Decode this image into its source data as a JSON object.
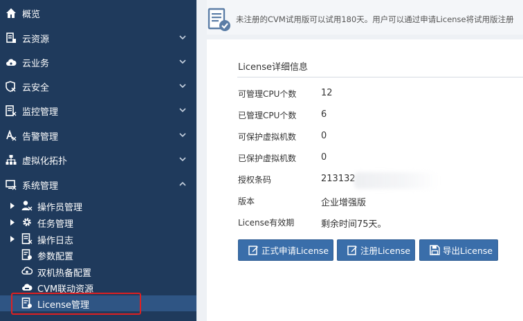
{
  "sidebar": {
    "items": [
      {
        "label": "概览",
        "icon": "home-icon",
        "expanded": false
      },
      {
        "label": "云资源",
        "icon": "server-icon",
        "expanded": false
      },
      {
        "label": "云业务",
        "icon": "cloud-icon",
        "expanded": false
      },
      {
        "label": "云安全",
        "icon": "shield-icon",
        "expanded": false
      },
      {
        "label": "监控管理",
        "icon": "monitor-doc-icon",
        "expanded": false
      },
      {
        "label": "告警管理",
        "icon": "alarm-icon",
        "expanded": false
      },
      {
        "label": "虚拟化拓扑",
        "icon": "topology-icon",
        "expanded": false
      },
      {
        "label": "系统管理",
        "icon": "system-icon",
        "expanded": true
      }
    ],
    "sub_items": [
      {
        "label": "操作员管理",
        "icon": "user-icon",
        "has_children": true
      },
      {
        "label": "任务管理",
        "icon": "gear-icon",
        "has_children": true
      },
      {
        "label": "操作日志",
        "icon": "log-icon",
        "has_children": true
      },
      {
        "label": "参数配置",
        "icon": "param-doc-icon",
        "has_children": false
      },
      {
        "label": "双机热备配置",
        "icon": "cloud-sync-icon",
        "has_children": false
      },
      {
        "label": "CVM联动资源",
        "icon": "cvm-cloud-icon",
        "has_children": false
      },
      {
        "label": "License管理",
        "icon": "license-doc-icon",
        "has_children": false,
        "active": true
      }
    ]
  },
  "banner": {
    "text": "未注册的CVM试用版可以试用180天。用户可以通过申请License将试用版注册"
  },
  "panel": {
    "title": "License详细信息",
    "rows": [
      {
        "label": "可管理CPU个数",
        "value": "12"
      },
      {
        "label": "已管理CPU个数",
        "value": "6"
      },
      {
        "label": "可保护虚拟机数",
        "value": "0"
      },
      {
        "label": "已保护虚拟机数",
        "value": "0"
      },
      {
        "label": "授权条码",
        "value": "213132"
      },
      {
        "label": "版本",
        "value": "企业增强版"
      },
      {
        "label": "License有效期",
        "value": "剩余时间75天。"
      }
    ]
  },
  "buttons": {
    "apply": "正式申请License",
    "register": "注册License",
    "export": "导出License"
  },
  "colors": {
    "sidebar_bg": "#1f3a5c",
    "sidebar_active": "#2f5584",
    "button": "#3a6eaa",
    "highlight": "#e02020"
  }
}
